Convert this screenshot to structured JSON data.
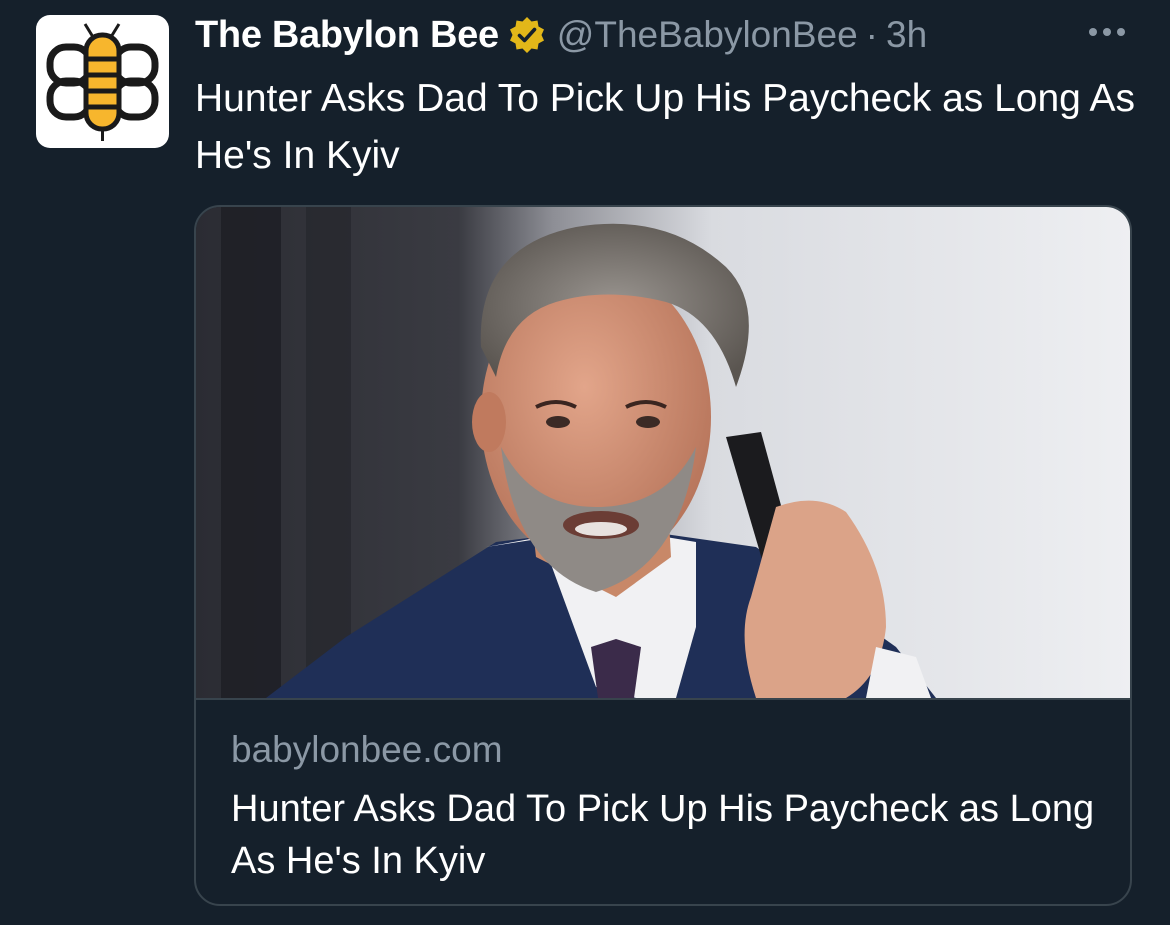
{
  "author": {
    "name": "The Babylon Bee",
    "handle": "@TheBabylonBee",
    "separator": "·",
    "time": "3h",
    "avatar_icon": "babylon-bee-logo-icon",
    "verified_icon": "verified-badge-icon"
  },
  "tweet": {
    "text": "Hunter Asks Dad To Pick Up His Paycheck as Long As He's In Kyiv"
  },
  "card": {
    "image_icon": "man-on-phone-photo",
    "domain": "babylonbee.com",
    "title": "Hunter Asks Dad To Pick Up His Paycheck as Long As He's In Kyiv"
  },
  "colors": {
    "background": "#15202b",
    "text_primary": "#ffffff",
    "text_secondary": "#8b98a5",
    "border": "#38444d",
    "verified_gold": "#e2b719",
    "bee_yellow": "#f7b62d"
  }
}
